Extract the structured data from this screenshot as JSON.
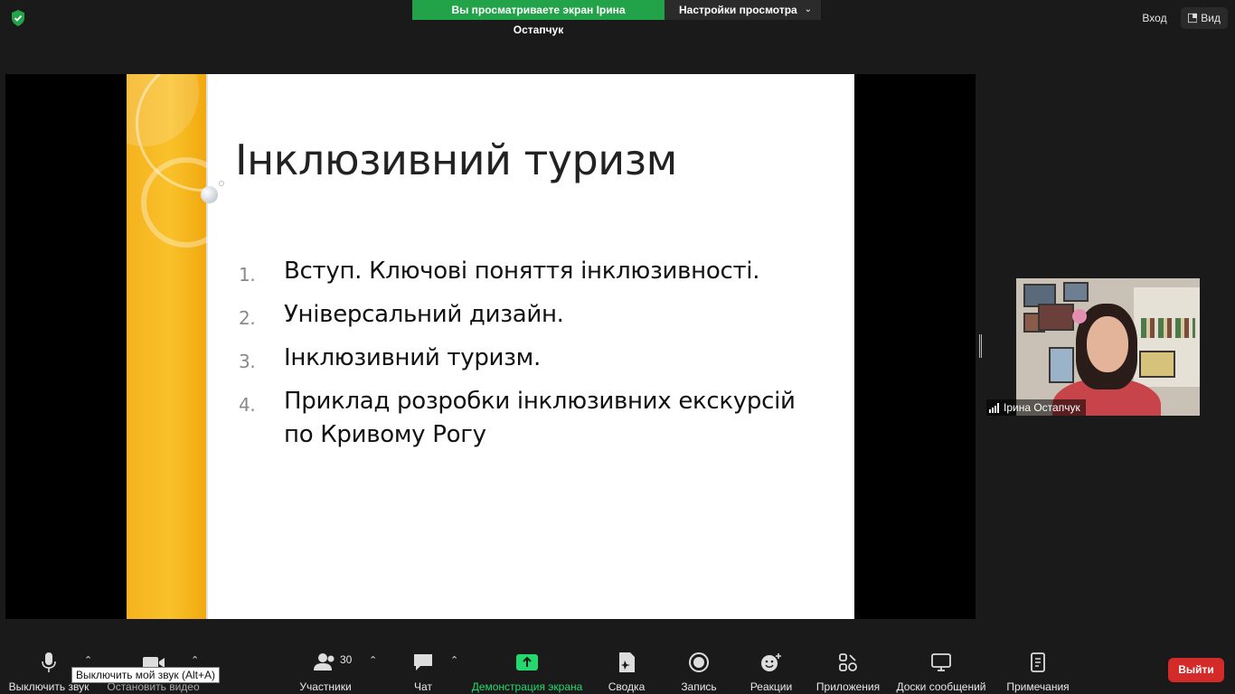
{
  "top_bar": {
    "banner_text": "Вы просматриваете экран Ірина Остапчук",
    "view_options_label": "Настройки просмотра",
    "login_label": "Вход",
    "view_label": "Вид"
  },
  "slide": {
    "title": "Інклюзивний туризм",
    "items": [
      {
        "num": "1.",
        "text": "Вступ. Ключові поняття інклюзивності."
      },
      {
        "num": "2.",
        "text": "Універсальний дизайн."
      },
      {
        "num": "3.",
        "text": "Інклюзивний туризм."
      },
      {
        "num": "4.",
        "text": "Приклад розробки інклюзивних екскурсій по Кривому Рогу"
      }
    ]
  },
  "participant": {
    "name": "Ірина Остапчук"
  },
  "toolbar": {
    "mute_label": "Выключить звук",
    "video_label": "Остановить видео",
    "participants_label": "Участники",
    "participants_count": "30",
    "chat_label": "Чат",
    "share_label": "Демонстрация экрана",
    "summary_label": "Сводка",
    "record_label": "Запись",
    "reactions_label": "Реакции",
    "apps_label": "Приложения",
    "whiteboards_label": "Доски сообщений",
    "notes_label": "Примечания",
    "exit_label": "Выйти",
    "mute_tooltip": "Выключить мой звук (Alt+A)"
  },
  "colors": {
    "green": "#23a349",
    "share_green": "#23d96e",
    "exit_red": "#d52a2a",
    "slide_band": "#f9c12a"
  }
}
